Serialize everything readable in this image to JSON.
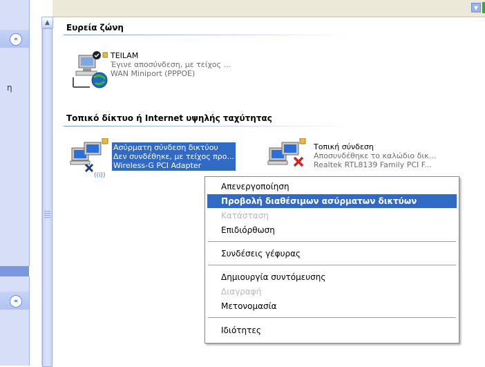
{
  "groups": {
    "broadband": {
      "title": "Ευρεία ζώνη"
    },
    "lan": {
      "title": "Τοπικό δίκτυο ή Internet υψηλής ταχύτητας"
    }
  },
  "connections": {
    "teilam": {
      "name": "TEILAM",
      "status": "Έγινε αποσύνδεση, με τείχος ...",
      "device": "WAN Miniport (PPPOE)"
    },
    "wireless": {
      "name": "Ασύρματη σύνδεση δικτύου",
      "status": "Δεν συνδέθηκε, με τείχος προ...",
      "device": "Wireless-G PCI Adapter"
    },
    "local": {
      "name": "Τοπική σύνδεση",
      "status": "Αποσυνδέθηκε το καλώδιο δικ...",
      "device": "Realtek RTL8139 Family PCI F..."
    }
  },
  "context_menu": {
    "disable": "Απενεργοποίηση",
    "view_wireless": "Προβολή διαθέσιμων ασύρματων δικτύων",
    "status": "Κατάσταση",
    "repair": "Επιδιόρθωση",
    "bridge": "Συνδέσεις γέφυρας",
    "shortcut": "Δημιουργία συντόμευσης",
    "delete": "Διαγραφή",
    "rename": "Μετονομασία",
    "properties": "Ιδιότητες"
  },
  "left_pane": {
    "partial_text": "η"
  },
  "colors": {
    "selection": "#316ac5",
    "task_pane": "#d6dff7",
    "task_pane_bg": "#7a96df",
    "group_line": "#7a96df"
  }
}
